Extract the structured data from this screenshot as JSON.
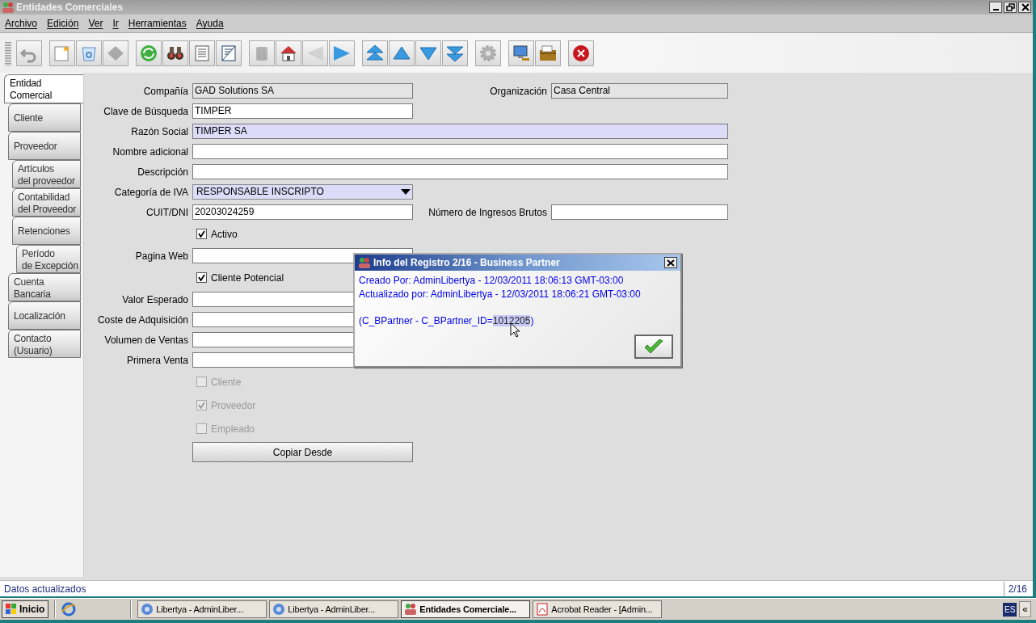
{
  "window": {
    "title": "Entidades Comerciales"
  },
  "menu": [
    "Archivo",
    "Edición",
    "Ver",
    "Ir",
    "Herramientas",
    "Ayuda"
  ],
  "toolbar_groups": [
    [
      {
        "disabled": true
      }
    ],
    [
      {
        "disabled": false
      },
      {
        "disabled": false
      },
      {
        "disabled": true
      }
    ],
    [
      {
        "disabled": false
      },
      {
        "disabled": false
      },
      {
        "disabled": false
      },
      {
        "disabled": false
      }
    ],
    [
      {
        "disabled": true
      },
      {
        "disabled": false
      },
      {
        "disabled": true
      },
      {
        "disabled": false
      }
    ],
    [
      {
        "disabled": false
      },
      {
        "disabled": false
      },
      {
        "disabled": false
      },
      {
        "disabled": false
      }
    ],
    [
      {
        "disabled": true
      }
    ],
    [
      {
        "disabled": false
      },
      {
        "disabled": false
      }
    ],
    [
      {
        "disabled": false
      }
    ]
  ],
  "tabs": [
    {
      "label": "Entidad\nComercial",
      "selected": true,
      "children": [
        {
          "label": "Cliente",
          "selected": false
        },
        {
          "label": "Proveedor",
          "selected": false,
          "children": [
            {
              "label": "Artículos\ndel proveedor",
              "selected": false
            },
            {
              "label": "Contabilidad\ndel Proveedor",
              "selected": false
            },
            {
              "label": "Retenciones",
              "selected": false,
              "children": [
                {
                  "label": "Período\nde Excepción",
                  "selected": false
                }
              ]
            }
          ]
        },
        {
          "label": "Cuenta\nBancaria",
          "selected": false
        },
        {
          "label": "Localización",
          "selected": false
        },
        {
          "label": "Contacto\n(Usuario)",
          "selected": false
        }
      ]
    }
  ],
  "form": [
    {
      "kind": "text",
      "label": "Compañía",
      "value": "GAD Solutions SA",
      "readonly": true,
      "mandatory": false,
      "side": {
        "label": "Organización",
        "value": "Casa Central",
        "readonly": true
      }
    },
    {
      "kind": "text",
      "label": "Clave de Búsqueda",
      "value": "TIMPER",
      "readonly": false,
      "mandatory": false
    },
    {
      "kind": "text",
      "label": "Razón Social",
      "value": "TIMPER SA",
      "readonly": false,
      "mandatory": true
    },
    {
      "kind": "text",
      "label": "Nombre adicional",
      "readonly": false,
      "mandatory": false
    },
    {
      "kind": "text",
      "label": "Descripción",
      "readonly": false,
      "mandatory": false
    },
    {
      "kind": "combo",
      "label": "Categoría de IVA",
      "value": "RESPONSABLE INSCRIPTO",
      "mandatory": true
    },
    {
      "kind": "text",
      "label": "CUIT/DNI",
      "value": "20203024259",
      "readonly": false,
      "mandatory": false,
      "side": {
        "label": "Número de Ingresos Brutos",
        "readonly": false
      }
    },
    {
      "kind": "checkbox",
      "label": "Activo",
      "checked": true,
      "disabled": false
    },
    {
      "kind": "text",
      "label": "Pagina Web",
      "readonly": false,
      "mandatory": false
    },
    {
      "kind": "checkbox",
      "label": "Cliente Potencial",
      "checked": true,
      "disabled": false
    },
    {
      "kind": "text",
      "label": "Valor Esperado",
      "readonly": false,
      "mandatory": false
    },
    {
      "kind": "text",
      "label": "Coste de Adquisición",
      "readonly": false,
      "mandatory": false
    },
    {
      "kind": "text",
      "label": "Volumen de Ventas",
      "readonly": false,
      "mandatory": false
    },
    {
      "kind": "text",
      "label": "Primera Venta",
      "readonly": false,
      "mandatory": false
    },
    {
      "kind": "checkbox",
      "label": "Cliente",
      "checked": false,
      "disabled": true
    },
    {
      "kind": "checkbox",
      "label": "Proveedor",
      "checked": true,
      "disabled": true
    },
    {
      "kind": "checkbox",
      "label": "Empleado",
      "checked": false,
      "disabled": true
    },
    {
      "kind": "button",
      "label": "Copiar Desde"
    }
  ],
  "dialog": {
    "title": "Info del Registro 2/16 - Business Partner",
    "lines": [
      "Creado Por: AdminLibertya - 12/03/2011 18:06:13 GMT-03:00",
      "Actualizado por: AdminLibertya - 12/03/2011 18:06:21 GMT-03:00"
    ],
    "id_line": {
      "text": "(C_BPartner - C_BPartner_ID=",
      "selected_text": "1012205",
      "text_after": ")"
    }
  },
  "status_bar": {
    "message": "Datos actualizados",
    "record": "2/16"
  },
  "taskbar": {
    "start": "Inicio",
    "tasks": [
      {
        "label": "Libertya - AdminLiber...",
        "selected": false
      },
      {
        "label": "Libertya - AdminLiber...",
        "selected": false
      },
      {
        "label": "Entidades Comerciale...",
        "selected": true
      },
      {
        "label": "Acrobat Reader - [Admin...",
        "selected": false
      }
    ],
    "language": "ES",
    "tray_toggle": "«"
  }
}
